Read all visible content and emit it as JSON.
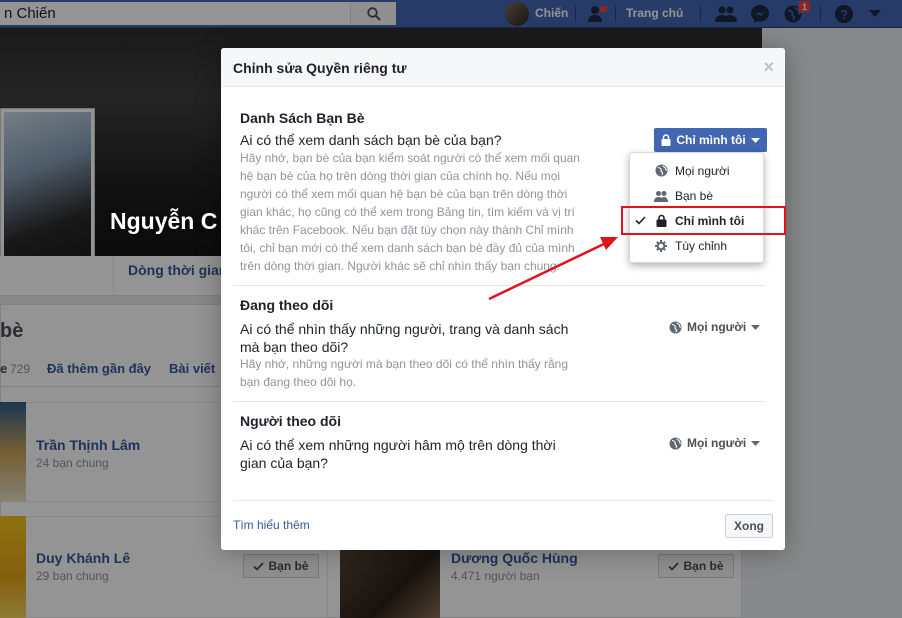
{
  "topbar": {
    "search_value": "n Chiến",
    "user_name": "Chiến",
    "home_label": "Trang chủ",
    "notification_count": "1",
    "icons": [
      "search-icon",
      "friend-requests-icon",
      "messenger-icon",
      "globe-notifications-icon",
      "help-icon",
      "caret-down-icon"
    ]
  },
  "profile": {
    "name": "Nguyễn C",
    "timeline_tab": "Dòng thời gian"
  },
  "friends": {
    "title": "bè",
    "tab_all_suffix": "e",
    "count": "729",
    "tab_recent": "Đã thêm gần đây",
    "tab_posts": "Bài viết",
    "items": [
      {
        "name": "Trần Thịnh Lâm",
        "sub": "24 bạn chung"
      },
      {
        "name": "Duy Khánh Lê",
        "sub": "29 bạn chung",
        "button": "Bạn bè"
      },
      {
        "name": "Dương Quốc Hùng",
        "sub": "4.471 người bạn",
        "button": "Bạn bè"
      }
    ]
  },
  "dialog": {
    "title": "Chỉnh sửa Quyền riêng tư",
    "close_glyph": "×",
    "sections": [
      {
        "title": "Danh Sách Bạn Bè",
        "question": "Ai có thể xem danh sách bạn bè của bạn?",
        "hint": "Hãy nhớ, bạn bè của bạn kiểm soát người có thể xem mối quan hệ bạn bè của họ trên dòng thời gian của chính họ. Nếu mọi người có thể xem mối quan hệ bạn bè của bạn trên dòng thời gian khác, họ cũng có thể xem trong Bảng tin, tìm kiếm và vị trí khác trên Facebook. Nếu bạn đặt tùy chọn này thành Chỉ mình tôi, chỉ bạn mới có thể xem danh sách bạn bè đầy đủ của mình trên dòng thời gian. Người khác sẽ chỉ nhìn thấy bạn chung.",
        "audience": "Chỉ mình tôi"
      },
      {
        "title": "Đang theo dõi",
        "question": "Ai có thể nhìn thấy những người, trang và danh sách mà bạn theo dõi?",
        "hint": "Hãy nhớ, những người mà bạn theo dõi có thể nhìn thấy rằng bạn đang theo dõi họ.",
        "audience": "Mọi người"
      },
      {
        "title": "Người theo dõi",
        "question": "Ai có thể xem những người hâm mộ trên dòng thời gian của bạn?",
        "audience": "Mọi người"
      }
    ],
    "learn_more": "Tìm hiểu thêm",
    "close_button": "Xong"
  },
  "audience_menu": {
    "items": [
      {
        "label": "Mọi người",
        "icon": "globe-icon",
        "selected": false
      },
      {
        "label": "Bạn bè",
        "icon": "friends-icon",
        "selected": false
      },
      {
        "label": "Chỉ mình tôi",
        "icon": "lock-icon",
        "selected": true
      },
      {
        "label": "Tùy chỉnh",
        "icon": "gear-icon",
        "selected": false
      }
    ]
  },
  "colors": {
    "facebook_blue": "#4267b2",
    "link": "#365899",
    "annotation_red": "#e3111b"
  }
}
